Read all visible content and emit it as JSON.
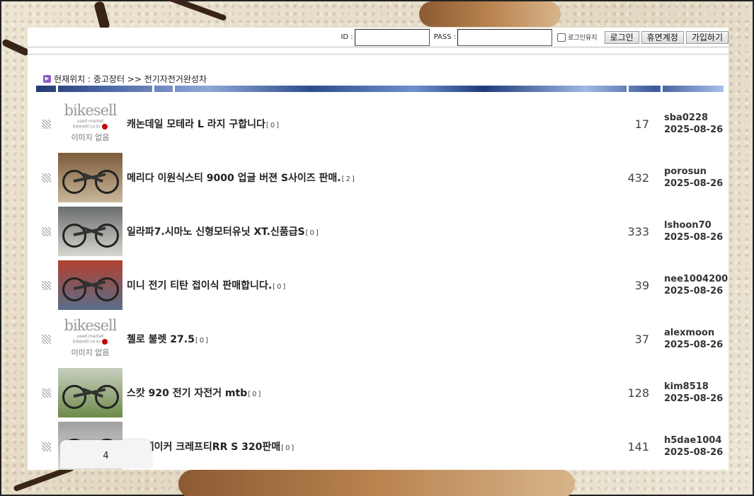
{
  "login": {
    "id_label": "ID :",
    "pass_label": "PASS :",
    "remember_label": "로그인유지",
    "login_button": "로그인",
    "dormant_button": "휴면계정",
    "join_button": "가입하기"
  },
  "breadcrumb": {
    "icon": "arrow-right-icon",
    "text": "현재위치 : 중고장터 >> 전기자전거완성차"
  },
  "no_image": {
    "logo": "bikesell",
    "sub1": "used market",
    "sub2": "bikesell.co.kr",
    "label": "이미지 없음"
  },
  "posts": [
    {
      "title": "캐논데일 모테라 L 라지 구합니다",
      "comments": "[0]",
      "views": "17",
      "author": "sba0228",
      "date": "2025-08-26",
      "thumb": "none"
    },
    {
      "title": "메리다 이원식스티 9000 업글 버젼 S사이즈 판매.",
      "comments": "[2]",
      "views": "432",
      "author": "porosun",
      "date": "2025-08-26",
      "thumb": "photo"
    },
    {
      "title": "일라파7.시마노 신형모터유닛 XT.신품급S",
      "comments": "[0]",
      "views": "333",
      "author": "lshoon70",
      "date": "2025-08-26",
      "thumb": "photo"
    },
    {
      "title": "미니 전기 티탄 접이식 판매합니다.",
      "comments": "[0]",
      "views": "39",
      "author": "nee1004200",
      "date": "2025-08-26",
      "thumb": "photo"
    },
    {
      "title": "첼로 불렛 27.5",
      "comments": "[0]",
      "views": "37",
      "author": "alexmoon",
      "date": "2025-08-26",
      "thumb": "none"
    },
    {
      "title": "스캇 920 전기 자전거 mtb",
      "comments": "[0]",
      "views": "128",
      "author": "kim8518",
      "date": "2025-08-26",
      "thumb": "photo"
    },
    {
      "title": "트렉레이커 크레프티RR S 320판매",
      "comments": "[0]",
      "views": "141",
      "author": "h5dae1004",
      "date": "2025-08-26",
      "thumb": "photo"
    }
  ],
  "pagination": {
    "current": "4"
  }
}
